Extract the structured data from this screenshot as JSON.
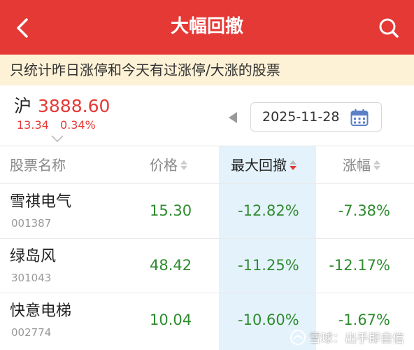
{
  "header": {
    "title": "大幅回撤",
    "back_icon": "chevron-left-icon",
    "search_icon": "search-icon",
    "bg_color": "#e53935"
  },
  "notice": "只统计昨日涨停和今天有过涨停/大涨的股票",
  "index": {
    "name": "沪",
    "value": "3888.60",
    "change": "13.34",
    "change_pct": "0.34%",
    "color": "#e53935"
  },
  "date_picker": {
    "date": "2025-11-28",
    "prev_icon": "triangle-left-icon",
    "calendar_icon": "calendar-icon"
  },
  "table": {
    "headers": {
      "name": "股票名称",
      "price": "价格",
      "drawdown": "最大回撤",
      "change": "涨幅"
    },
    "sorted_column": "drawdown",
    "sort_direction": "desc",
    "rows": [
      {
        "name": "雪祺电气",
        "code": "001387",
        "price": "15.30",
        "drawdown": "-12.82%",
        "change": "-7.38%"
      },
      {
        "name": "绿岛风",
        "code": "301043",
        "price": "48.42",
        "drawdown": "-11.25%",
        "change": "-12.17%"
      },
      {
        "name": "快意电梯",
        "code": "002774",
        "price": "10.04",
        "drawdown": "-10.60%",
        "change": "-1.67%"
      }
    ],
    "down_color": "#2e8b2e",
    "highlight_color": "#e4f2fc"
  },
  "watermark": "雪球：出手即自信"
}
